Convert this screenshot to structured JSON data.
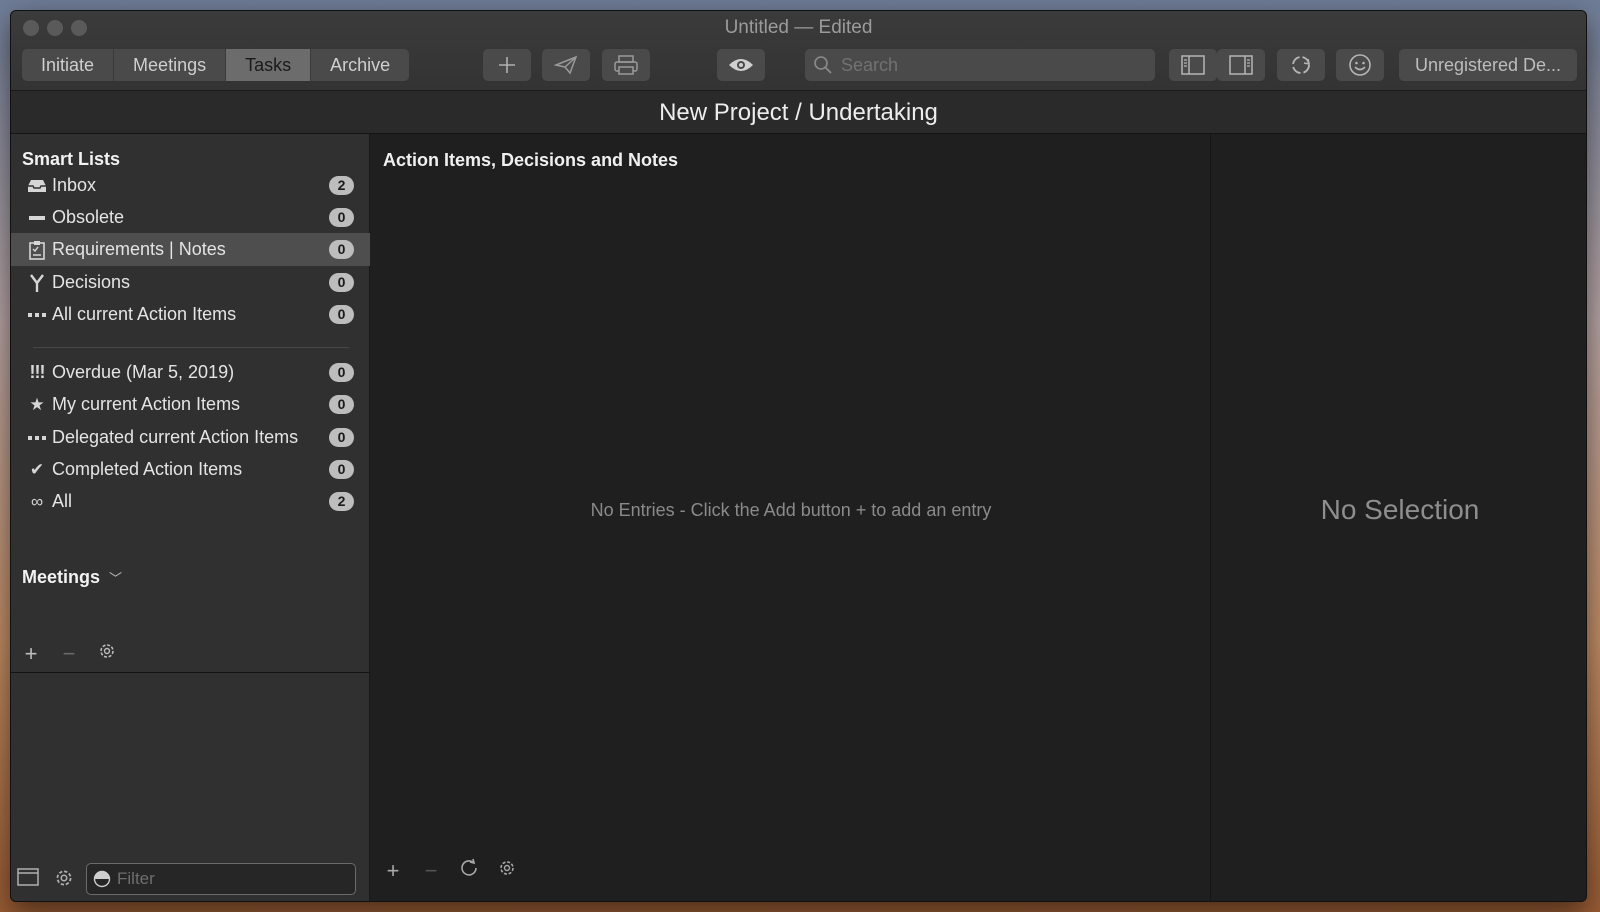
{
  "window": {
    "title": "Untitled — Edited"
  },
  "toolbar": {
    "tabs": [
      {
        "label": "Initiate"
      },
      {
        "label": "Meetings"
      },
      {
        "label": "Tasks",
        "active": true
      },
      {
        "label": "Archive"
      }
    ],
    "search_placeholder": "Search",
    "registration_label": "Unregistered De..."
  },
  "project": {
    "title": "New Project / Undertaking"
  },
  "sidebar": {
    "smart_lists_title": "Smart Lists",
    "items": [
      {
        "label": "Inbox",
        "count": "2",
        "icon": "inbox-icon"
      },
      {
        "label": "Obsolete",
        "count": "0",
        "icon": "minus-icon"
      },
      {
        "label": "Requirements | Notes",
        "count": "0",
        "icon": "clipboard-icon",
        "selected": true
      },
      {
        "label": "Decisions",
        "count": "0",
        "icon": "fork-icon"
      },
      {
        "label": "All current Action Items",
        "count": "0",
        "icon": "dots-icon"
      },
      {
        "label": "Overdue (Mar 5, 2019)",
        "count": "0",
        "icon": "exclamation-icon"
      },
      {
        "label": "My current Action Items",
        "count": "0",
        "icon": "star-icon"
      },
      {
        "label": "Delegated current Action Items",
        "count": "0",
        "icon": "dots-icon"
      },
      {
        "label": "Completed Action Items",
        "count": "0",
        "icon": "checkmark-icon"
      },
      {
        "label": "All",
        "count": "2",
        "icon": "infinity-icon"
      }
    ],
    "meetings_title": "Meetings",
    "filter_placeholder": "Filter"
  },
  "main": {
    "title": "Action Items, Decisions and Notes",
    "empty_message": "No Entries - Click the Add button + to add an entry"
  },
  "detail": {
    "empty_message": "No Selection"
  }
}
